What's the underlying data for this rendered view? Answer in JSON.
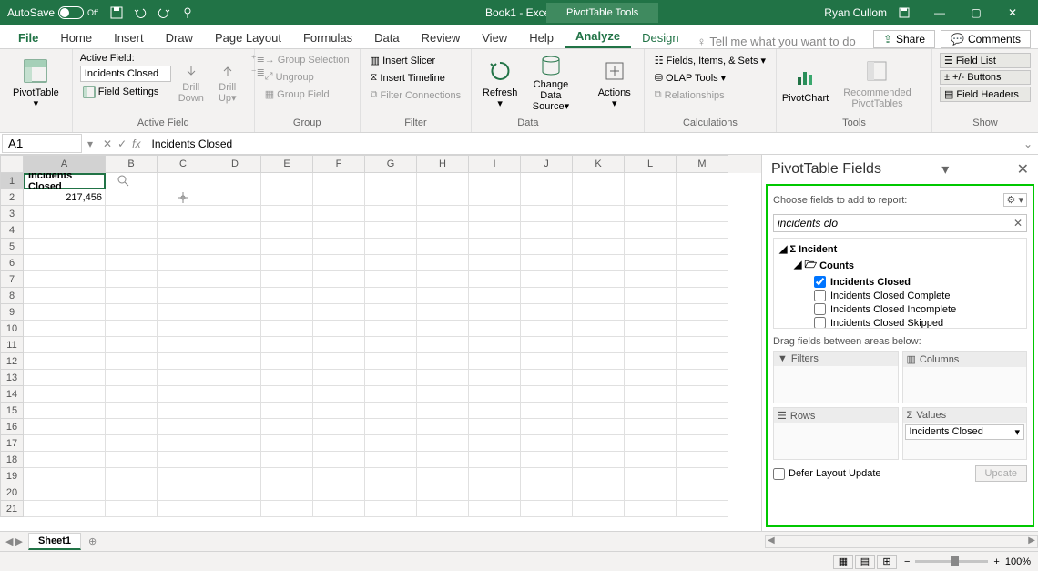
{
  "titlebar": {
    "autosave": "AutoSave",
    "autosave_state": "Off",
    "book": "Book1 - Excel",
    "tools": "PivotTable Tools",
    "user": "Ryan Cullom"
  },
  "tabs": {
    "file": "File",
    "home": "Home",
    "insert": "Insert",
    "draw": "Draw",
    "page_layout": "Page Layout",
    "formulas": "Formulas",
    "data": "Data",
    "review": "Review",
    "view": "View",
    "help": "Help",
    "analyze": "Analyze",
    "design": "Design",
    "tellme": "Tell me what you want to do",
    "share": "Share",
    "comments": "Comments"
  },
  "ribbon": {
    "pivottable": "PivotTable",
    "active_field_lbl": "Active Field:",
    "active_field_value": "Incidents Closed",
    "field_settings": "Field Settings",
    "drill_down": "Drill Down",
    "drill_up": "Drill Up",
    "group_active_field": "Active Field",
    "group_selection": "Group Selection",
    "ungroup": "Ungroup",
    "group_field": "Group Field",
    "group_group": "Group",
    "insert_slicer": "Insert Slicer",
    "insert_timeline": "Insert Timeline",
    "filter_connections": "Filter Connections",
    "group_filter": "Filter",
    "refresh": "Refresh",
    "change_data_source": "Change Data Source",
    "group_data": "Data",
    "actions": "Actions",
    "fields_items_sets": "Fields, Items, & Sets",
    "olap_tools": "OLAP Tools",
    "relationships": "Relationships",
    "group_calc": "Calculations",
    "pivotchart": "PivotChart",
    "rec_pivottables": "Recommended PivotTables",
    "group_tools": "Tools",
    "field_list": "Field List",
    "pm_buttons": "+/- Buttons",
    "field_headers": "Field Headers",
    "group_show": "Show"
  },
  "formula": {
    "namebox": "A1",
    "fx_label": "fx",
    "value": "Incidents Closed"
  },
  "grid": {
    "cols": [
      "A",
      "B",
      "C",
      "D",
      "E",
      "F",
      "G",
      "H",
      "I",
      "J",
      "K",
      "L",
      "M"
    ],
    "row_count": 21,
    "a1": "Incidents Closed",
    "a2": "217,456"
  },
  "sheets": {
    "sheet1": "Sheet1"
  },
  "panel": {
    "title": "PivotTable Fields",
    "subtitle": "Choose fields to add to report:",
    "search": "incidents clo",
    "tree": {
      "root": "Incident",
      "counts": "Counts",
      "items": [
        {
          "label": "Incidents Closed",
          "checked": true
        },
        {
          "label": "Incidents Closed Complete",
          "checked": false
        },
        {
          "label": "Incidents Closed Incomplete",
          "checked": false
        },
        {
          "label": "Incidents Closed Skipped",
          "checked": false
        }
      ]
    },
    "drag_label": "Drag fields between areas below:",
    "filters": "Filters",
    "columns": "Columns",
    "rows": "Rows",
    "values": "Values",
    "values_item": "Incidents Closed",
    "defer": "Defer Layout Update",
    "update": "Update"
  },
  "status": {
    "zoom": "100%"
  }
}
